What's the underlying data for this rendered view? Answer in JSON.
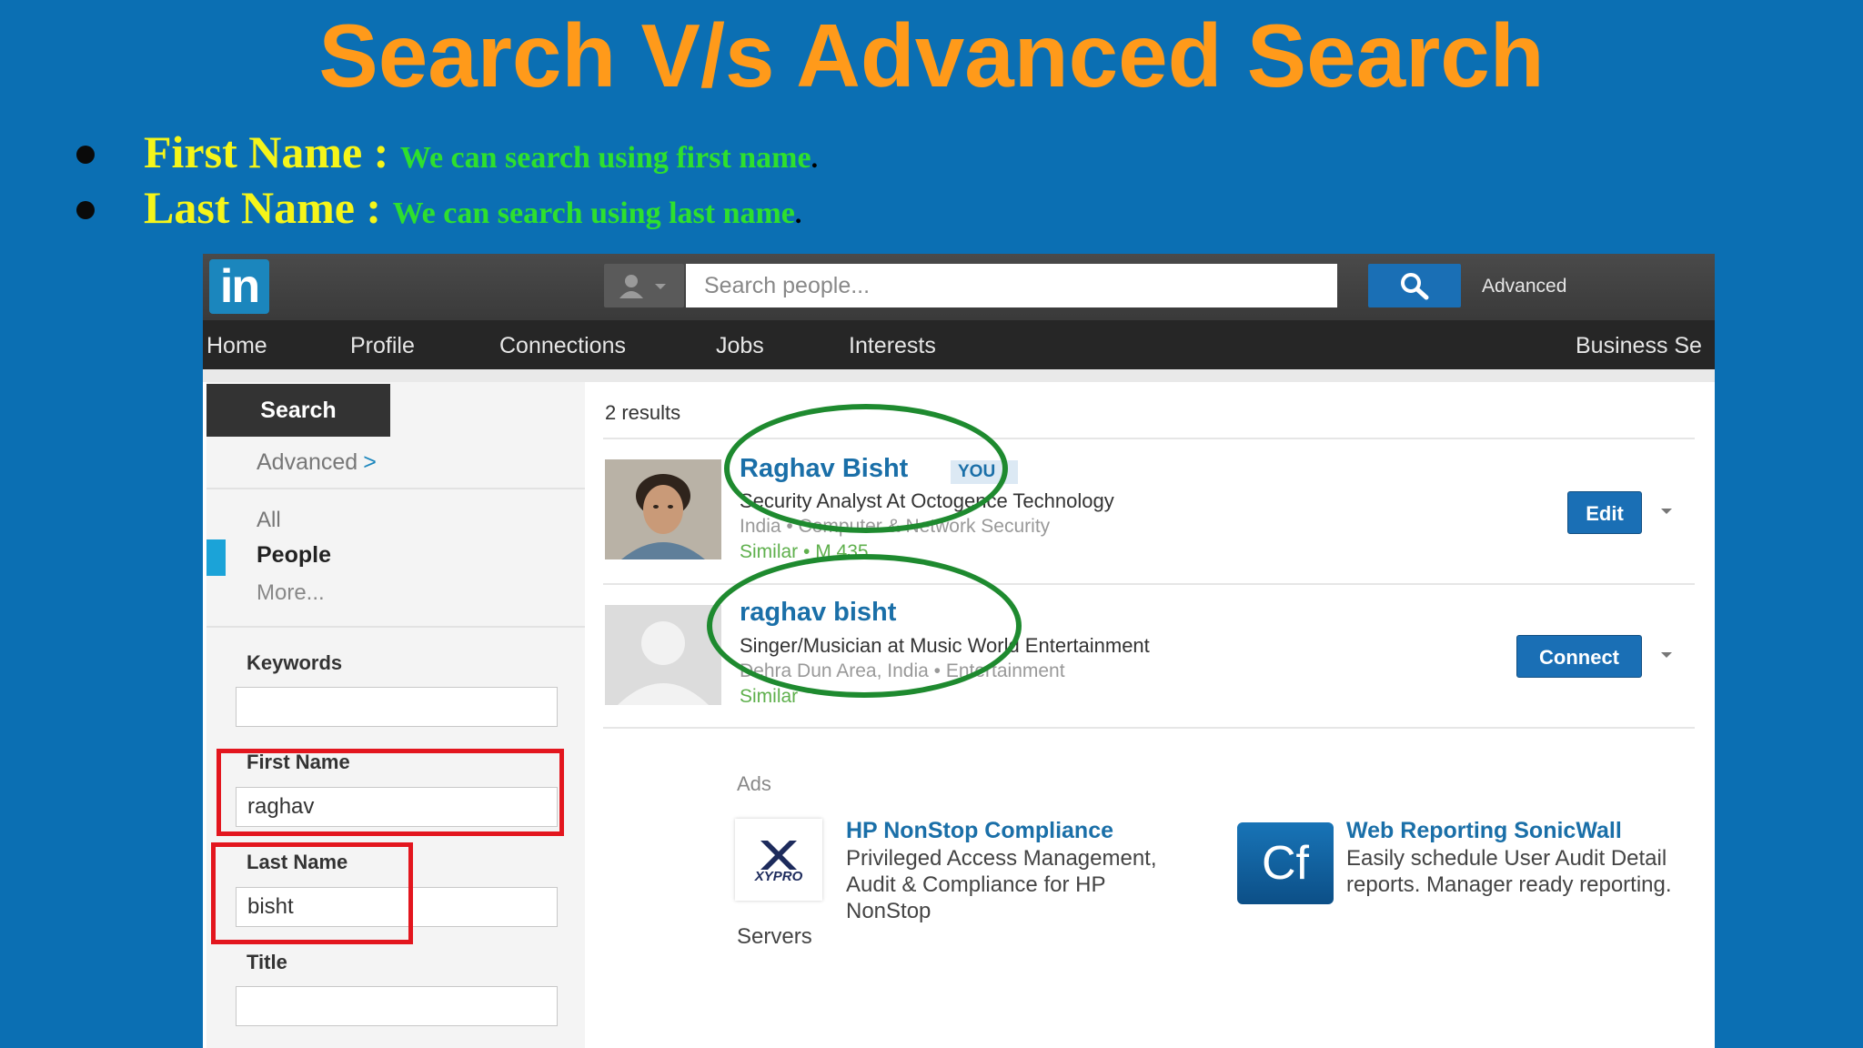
{
  "slide": {
    "title": "Search V/s Advanced Search",
    "bullets": [
      {
        "label": "First Name :",
        "desc": "We can search using first name"
      },
      {
        "label": "Last Name :",
        "desc": "We can search using last name"
      }
    ]
  },
  "app": {
    "logo_text": "in",
    "search": {
      "placeholder": "Search people...",
      "advanced_label": "Advanced"
    },
    "nav": [
      "Home",
      "Profile",
      "Connections",
      "Jobs",
      "Interests",
      "Business Se"
    ]
  },
  "sidebar": {
    "search_tab": "Search",
    "advanced_link": "Advanced",
    "advanced_chevron": ">",
    "filters": {
      "all": "All",
      "people": "People",
      "more": "More..."
    },
    "fields": {
      "keywords": {
        "label": "Keywords",
        "value": ""
      },
      "first_name": {
        "label": "First Name",
        "value": "raghav"
      },
      "last_name": {
        "label": "Last Name",
        "value": "bisht"
      },
      "title": {
        "label": "Title",
        "value": ""
      }
    }
  },
  "results": {
    "count_text": "2 results",
    "items": [
      {
        "name": "Raghav Bisht",
        "badge": "YOU",
        "headline": "Security Analyst At Octogence Technology",
        "meta": "India • Computer & Network Security",
        "similar": "Similar • M 435",
        "action": "Edit"
      },
      {
        "name": "raghav bisht",
        "badge": "",
        "headline": "Singer/Musician at Music World Entertainment",
        "meta": "Dehra Dun Area, India • Entertainment",
        "similar": "Similar",
        "action": "Connect"
      }
    ]
  },
  "ads": {
    "label": "Ads",
    "items": [
      {
        "logo_text": "XYPRO",
        "title": "HP NonStop Compliance",
        "desc": "Privileged Access Management, Audit & Compliance for HP NonStop",
        "overflow": "Servers"
      },
      {
        "logo_text": "Cf",
        "title": "Web Reporting SonicWall",
        "desc": "Easily schedule User Audit Detail reports. Manager ready reporting."
      }
    ]
  },
  "colors": {
    "slide_bg": "#0b6fb3",
    "title": "#ff9a1a",
    "bullet_label": "#f5f51a",
    "bullet_desc": "#2ee02e",
    "highlight_red": "#e3161e",
    "highlight_green": "#1e8a2f",
    "brand_blue": "#1a6fb5"
  }
}
